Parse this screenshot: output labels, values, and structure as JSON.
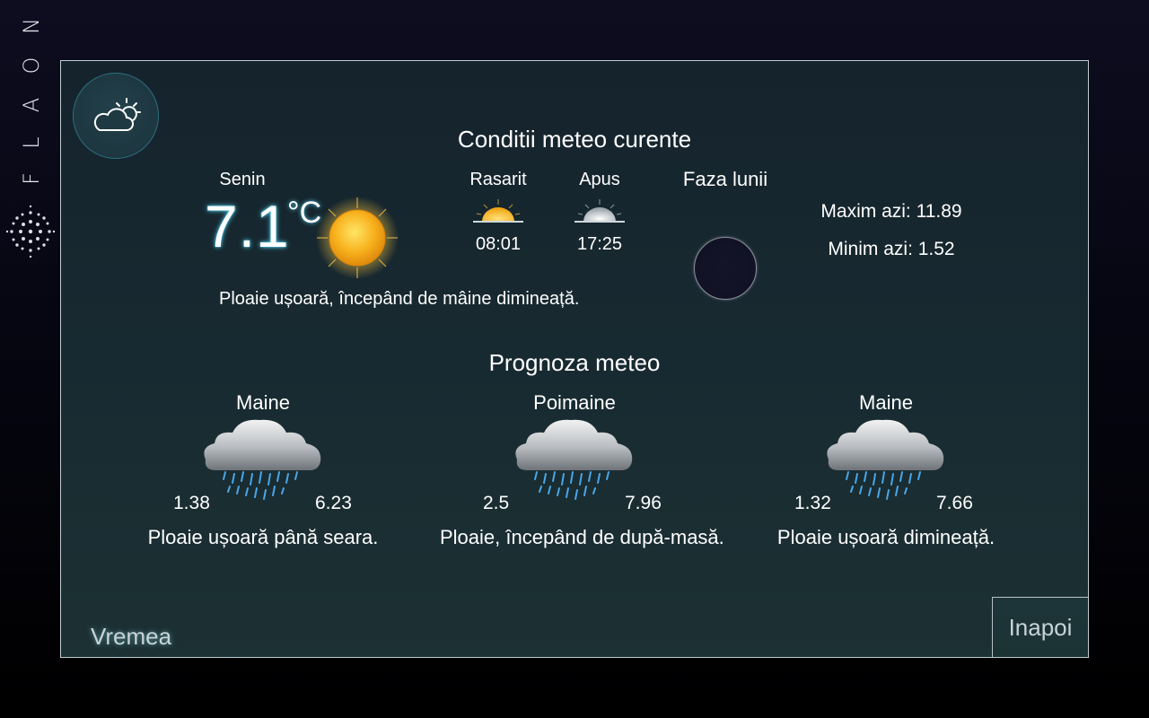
{
  "brand": {
    "letters": [
      "N",
      "O",
      "A",
      "L",
      "F"
    ]
  },
  "titles": {
    "current": "Conditii meteo curente",
    "forecast": "Prognoza meteo"
  },
  "current": {
    "condition": "Senin",
    "temperature": "7.1",
    "unit": "°C",
    "description": "Ploaie ușoară, începând de mâine dimineață.",
    "sunrise_label": "Rasarit",
    "sunrise_time": "08:01",
    "sunset_label": "Apus",
    "sunset_time": "17:25",
    "moon_label": "Faza lunii",
    "max_today": "Maxim azi: 11.89",
    "min_today": "Minim azi: 1.52"
  },
  "forecast": [
    {
      "day": "Maine",
      "min": "1.38",
      "max": "6.23",
      "description": "Ploaie ușoară până seara.",
      "icon": "rain-cloud-icon"
    },
    {
      "day": "Poimaine",
      "min": "2.5",
      "max": "7.96",
      "description": "Ploaie, începând de după-masă.",
      "icon": "rain-cloud-icon"
    },
    {
      "day": "Maine",
      "min": "1.32",
      "max": "7.66",
      "description": "Ploaie ușoară dimineață.",
      "icon": "rain-cloud-icon"
    }
  ],
  "footer": {
    "app_name": "Vremea",
    "back_label": "Inapoi"
  },
  "colors": {
    "accent_glow": "#4fd2f0",
    "panel_border": "#c4ccd0"
  }
}
